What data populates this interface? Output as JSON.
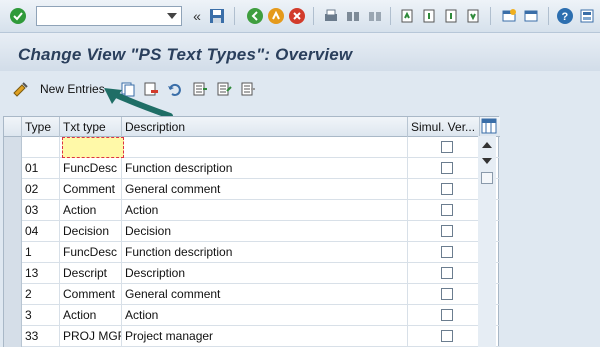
{
  "system_toolbar": {
    "command_field_value": "",
    "icons": [
      "check-icon",
      "back-icon",
      "save-icon",
      "back-nav-icon",
      "exit-icon",
      "cancel-icon",
      "print-icon",
      "find-icon",
      "find-next-icon",
      "first-page-icon",
      "prev-page-icon",
      "next-page-icon",
      "last-page-icon",
      "new-session-icon",
      "shortcut-icon",
      "help-icon",
      "customize-icon"
    ]
  },
  "title": "Change View \"PS Text Types\": Overview",
  "app_toolbar": {
    "new_entries_label": "New Entries"
  },
  "table": {
    "headers": {
      "type": "Type",
      "txt_type": "Txt type",
      "description": "Description",
      "simul": "Simul. Ver..."
    },
    "rows": [
      {
        "type": "",
        "txt_type": "",
        "description": ""
      },
      {
        "type": "01",
        "txt_type": "FuncDesc",
        "description": "Function description"
      },
      {
        "type": "02",
        "txt_type": "Comment",
        "description": "General comment"
      },
      {
        "type": "03",
        "txt_type": "Action",
        "description": "Action"
      },
      {
        "type": "04",
        "txt_type": "Decision",
        "description": "Decision"
      },
      {
        "type": "1",
        "txt_type": "FuncDesc",
        "description": "Function description"
      },
      {
        "type": "13",
        "txt_type": "Descript",
        "description": "Description"
      },
      {
        "type": "2",
        "txt_type": "Comment",
        "description": "General comment"
      },
      {
        "type": "3",
        "txt_type": "Action",
        "description": "Action"
      },
      {
        "type": "33",
        "txt_type": "PROJ MGR",
        "description": "Project manager"
      }
    ]
  },
  "colors": {
    "accent": "#2a3f5c",
    "annotation": "#1f6e66"
  }
}
